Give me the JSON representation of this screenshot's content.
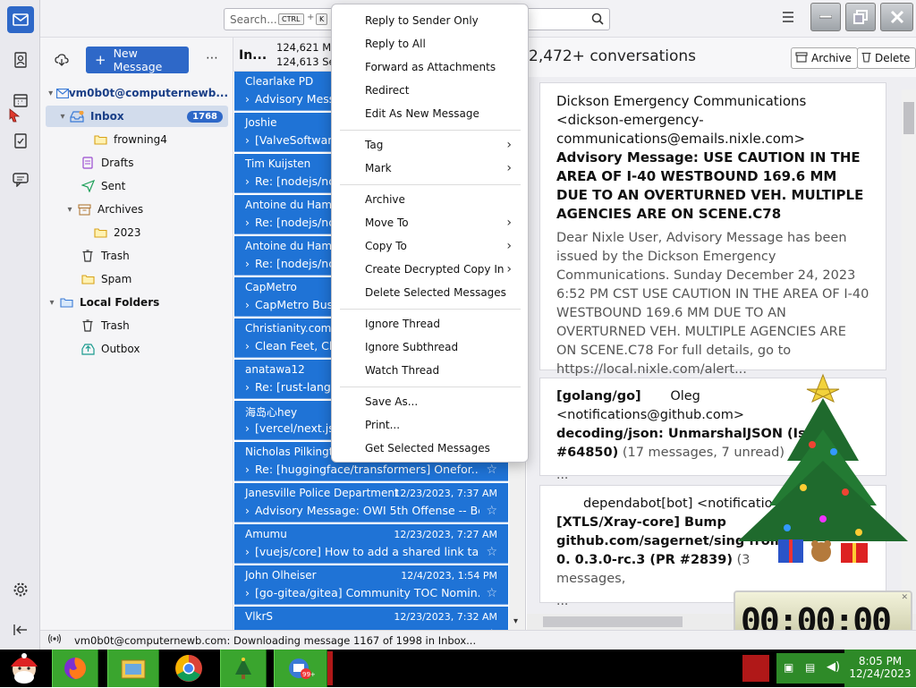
{
  "search": {
    "placeholder": "Search...",
    "key1": "CTRL",
    "plus": "+",
    "key2": "K"
  },
  "folders": {
    "new_message": "New Message",
    "account": "vm0b0t@computernewb...",
    "inbox": "Inbox",
    "inbox_count": "1768",
    "frowning": "frowning4",
    "drafts": "Drafts",
    "sent": "Sent",
    "archives": "Archives",
    "year": "2023",
    "trash": "Trash",
    "spam": "Spam",
    "local_folders": "Local Folders",
    "local_trash": "Trash",
    "outbox": "Outbox"
  },
  "list": {
    "header_folder": "In...",
    "count1": "124,621 Me",
    "count2": "124,613 Sele",
    "messages": [
      {
        "from": "Clearlake PD",
        "date": "",
        "subject": "Advisory Message"
      },
      {
        "from": "Joshie",
        "date": "",
        "subject": "[ValveSoftware"
      },
      {
        "from": "Tim Kuijsten",
        "date": "",
        "subject": "Re: [nodejs/nc"
      },
      {
        "from": "Antoine du Hamel",
        "date": "",
        "subject": "Re: [nodejs/nc"
      },
      {
        "from": "Antoine du Hamel",
        "date": "",
        "subject": "Re: [nodejs/nc"
      },
      {
        "from": "CapMetro",
        "date": "",
        "subject": "CapMetro Bus D"
      },
      {
        "from": "Christianity.com D",
        "date": "",
        "subject": "Clean Feet, Clear"
      },
      {
        "from": "anatawa12",
        "date": "",
        "subject": "Re: [rust-lang/"
      },
      {
        "from": "海岛心hey",
        "date": "",
        "subject": "[vercel/next.js]"
      },
      {
        "from": "Nicholas Pilkington",
        "date": "",
        "subject": "Re: [huggingface/transformers] Onefor..."
      },
      {
        "from": "Janesville Police Department",
        "date": "12/23/2023, 7:37 AM",
        "subject": "Advisory Message: OWI 5th Offense -- Bert..."
      },
      {
        "from": "Amumu",
        "date": "12/23/2023, 7:27 AM",
        "subject": "[vuejs/core] How to add a shared link ta..."
      },
      {
        "from": "John Olheiser",
        "date": "12/4/2023, 1:54 PM",
        "subject": "[go-gitea/gitea] Community TOC Nomin..."
      },
      {
        "from": "VlkrS",
        "date": "12/23/2023, 7:32 AM",
        "subject": ""
      }
    ]
  },
  "reading": {
    "conversations": "2,472+ conversations",
    "archive": "Archive",
    "delete": "Delete",
    "card1_from": "Dickson Emergency Communications <dickson-emergency-communications@emails.nixle.com>",
    "card1_subject": "Advisory Message: USE CAUTION IN THE AREA OF I-40 WESTBOUND 169.6 MM DUE TO AN OVERTURNED VEH. MULTIPLE AGENCIES ARE ON SCENE.C78",
    "card1_body": "Dear Nixle User, Advisory Message has been issued by the Dickson Emergency Communications. Sunday December 24, 2023 6:52 PM CST USE CAUTION IN THE AREA OF I-40 WESTBOUND 169.6 MM DUE TO AN OVERTURNED VEH. MULTIPLE AGENCIES ARE ON SCENE.C78 For full details, go to https://local.nixle.com/alert...",
    "card2_tag": "[golang/go]",
    "card2_from": "Oleg <notifications@github.com>",
    "card2_subject": "decoding/json: UnmarshalJSON (Issue #64850)",
    "card2_meta": "(17 messages, 7 unread)",
    "card2_more": "...",
    "card3_from": "dependabot[bot] <notificatio",
    "card3_subject": "[XTLS/Xray-core] Bump github.com/sagernet/sing from 0. 0.3.0-rc.3 (PR #2839)",
    "card3_meta": "(3 messages,",
    "card3_more": "..."
  },
  "status": {
    "text": "vm0b0t@computernewb.com: Downloading message 1167 of 1998 in Inbox..."
  },
  "context_menu": {
    "reply_sender": "Reply to Sender Only",
    "reply_all": "Reply to All",
    "forward_attach": "Forward as Attachments",
    "redirect": "Redirect",
    "edit_new": "Edit As New Message",
    "tag": "Tag",
    "mark": "Mark",
    "archive": "Archive",
    "move_to": "Move To",
    "copy_to": "Copy To",
    "decrypted_copy": "Create Decrypted Copy In",
    "delete_selected": "Delete Selected Messages",
    "ignore_thread": "Ignore Thread",
    "ignore_subthread": "Ignore Subthread",
    "watch_thread": "Watch Thread",
    "save_as": "Save As...",
    "print": "Print...",
    "get_selected": "Get Selected Messages"
  },
  "timer": {
    "text": "00:00:00"
  },
  "taskbar": {
    "time": "8:05 PM",
    "date": "12/24/2023"
  },
  "colors": {
    "accent": "#1f73d6",
    "button": "#2e68c8",
    "taskbar_green": "#3aa52e"
  }
}
